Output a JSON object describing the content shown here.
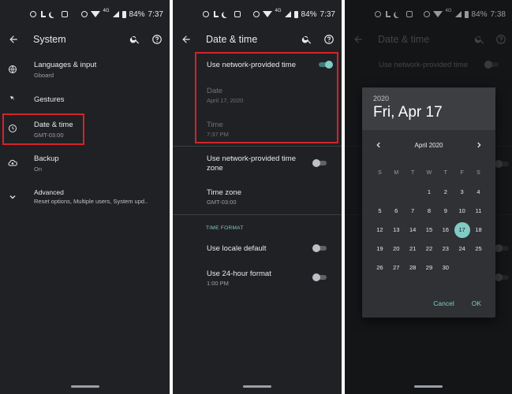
{
  "panel1": {
    "status": {
      "battery": "84%",
      "time": "7:37",
      "network": "4G"
    },
    "toolbar": {
      "title": "System"
    },
    "items": [
      {
        "title": "Languages & input",
        "subtitle": "Gboard"
      },
      {
        "title": "Gestures",
        "subtitle": ""
      },
      {
        "title": "Date & time",
        "subtitle": "GMT-03:00"
      },
      {
        "title": "Backup",
        "subtitle": "On"
      },
      {
        "title": "Advanced",
        "subtitle": "Reset options, Multiple users, System upd.."
      }
    ]
  },
  "panel2": {
    "status": {
      "battery": "84%",
      "time": "7:37",
      "network": "4G"
    },
    "toolbar": {
      "title": "Date & time"
    },
    "network_time": {
      "label": "Use network-provided time",
      "enabled": true
    },
    "date": {
      "label": "Date",
      "value": "April 17, 2020"
    },
    "time": {
      "label": "Time",
      "value": "7:37 PM"
    },
    "network_zone": {
      "label_line1": "Use network-provided time",
      "label_line2": "zone",
      "enabled": false
    },
    "timezone": {
      "label": "Time zone",
      "value": "GMT-03:00"
    },
    "section": "TIME FORMAT",
    "locale_default": {
      "label": "Use locale default",
      "enabled": false
    },
    "hour24": {
      "label": "Use 24-hour format",
      "value": "1:00 PM",
      "enabled": false
    }
  },
  "panel3": {
    "status": {
      "battery": "84%",
      "time": "7:38",
      "network": "4G"
    },
    "toolbar": {
      "title": "Date & time"
    },
    "background_item": "Use network-provided time",
    "dialog": {
      "year": "2020",
      "selected_date": "Fri, Apr 17",
      "month": "April 2020",
      "weekdays": [
        "S",
        "M",
        "T",
        "W",
        "T",
        "F",
        "S"
      ],
      "weeks": [
        [
          "",
          "",
          "",
          "1",
          "2",
          "3",
          "4"
        ],
        [
          "5",
          "6",
          "7",
          "8",
          "9",
          "10",
          "11"
        ],
        [
          "12",
          "13",
          "14",
          "15",
          "16",
          "17",
          "18"
        ],
        [
          "19",
          "20",
          "21",
          "22",
          "23",
          "24",
          "25"
        ],
        [
          "26",
          "27",
          "28",
          "29",
          "30",
          "",
          ""
        ]
      ],
      "selected_day": "17",
      "cancel": "Cancel",
      "ok": "OK"
    }
  },
  "colors": {
    "accent": "#80cbc4",
    "highlight": "#d3242a",
    "background": "#202124"
  }
}
